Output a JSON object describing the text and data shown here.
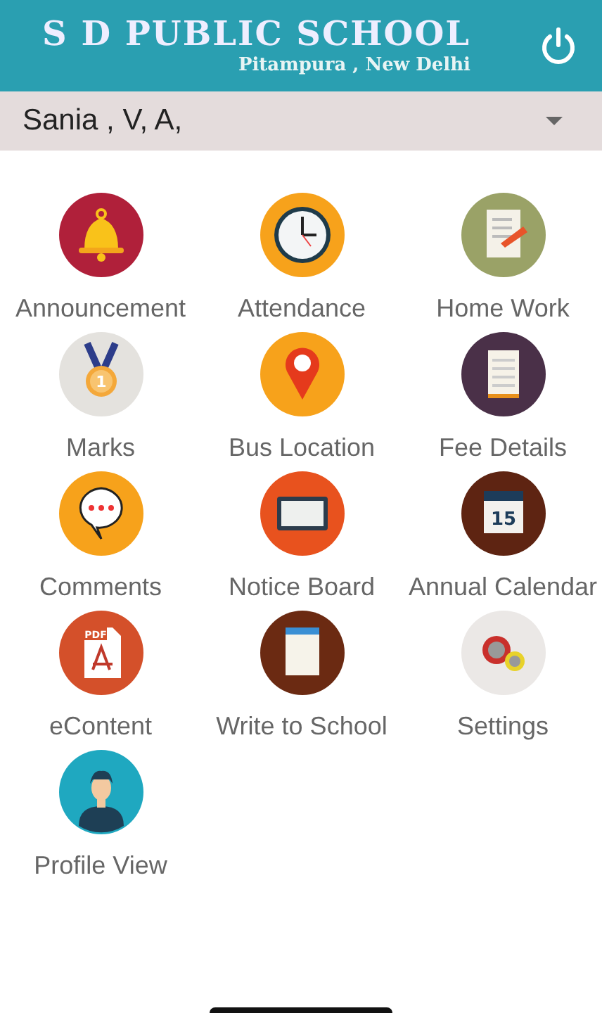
{
  "header": {
    "title": "S D PUBLIC SCHOOL",
    "subtitle": "Pitampura , New Delhi"
  },
  "student_select": {
    "value": "Sania , V, A,"
  },
  "menu": [
    {
      "label": "Announcement",
      "kind": "bell"
    },
    {
      "label": "Attendance",
      "kind": "clock"
    },
    {
      "label": "Home Work",
      "kind": "homework"
    },
    {
      "label": "Marks",
      "kind": "medal",
      "icon_text": "1"
    },
    {
      "label": "Bus Location",
      "kind": "pin"
    },
    {
      "label": "Fee Details",
      "kind": "notepad"
    },
    {
      "label": "Comments",
      "kind": "speech"
    },
    {
      "label": "Notice Board",
      "kind": "board"
    },
    {
      "label": "Annual Calendar",
      "kind": "calendar",
      "icon_text": "15"
    },
    {
      "label": "eContent",
      "kind": "pdf",
      "icon_text": "PDF"
    },
    {
      "label": "Write to School",
      "kind": "note"
    },
    {
      "label": "Settings",
      "kind": "gears"
    },
    {
      "label": "Profile View",
      "kind": "person"
    }
  ]
}
